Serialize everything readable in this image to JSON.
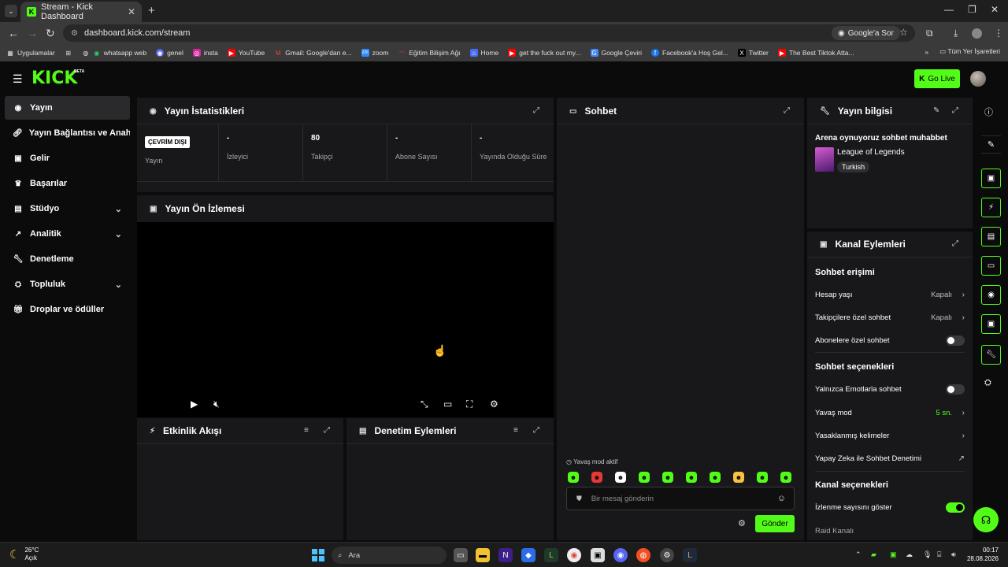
{
  "browser": {
    "tab_title": "Stream - Kick Dashboard",
    "url": "dashboard.kick.com/stream",
    "google_ask": "Google'a Sor",
    "bookmarks": [
      "Uygulamalar",
      "whatsapp web",
      "genel",
      "insta",
      "YouTube",
      "Gmail: Google'dan e...",
      "zoom",
      "Eğitim Bilişim Ağı",
      "Home",
      "get the fuck out my...",
      "Google Çeviri",
      "Facebook'a Hoş Gel...",
      "Twitter",
      "The Best Tiktok Atta..."
    ],
    "all_bookmarks": "Tüm Yer İşaretleri"
  },
  "header": {
    "logo": "KICK",
    "beta": "BETA",
    "go_live": "Go Live"
  },
  "sidebar": {
    "items": [
      {
        "label": "Yayın"
      },
      {
        "label": "Yayın Bağlantısı ve Anahtarı"
      },
      {
        "label": "Gelir"
      },
      {
        "label": "Başarılar"
      },
      {
        "label": "Stüdyo"
      },
      {
        "label": "Analitik"
      },
      {
        "label": "Denetleme"
      },
      {
        "label": "Topluluk"
      },
      {
        "label": "Droplar ve ödüller"
      }
    ]
  },
  "stats": {
    "title": "Yayın İstatistikleri",
    "offline": "ÇEVRİM DIŞI",
    "items": [
      {
        "value": "",
        "label": "Yayın"
      },
      {
        "value": "-",
        "label": "İzleyici"
      },
      {
        "value": "80",
        "label": "Takipçi"
      },
      {
        "value": "-",
        "label": "Abone Sayısı"
      },
      {
        "value": "-",
        "label": "Yayında Olduğu Süre"
      }
    ]
  },
  "preview": {
    "title": "Yayın Ön İzlemesi"
  },
  "activity": {
    "title": "Etkinlik Akışı"
  },
  "moderation": {
    "title": "Denetim Eylemleri"
  },
  "chat": {
    "title": "Sohbet",
    "slow_mode_note": "Yavaş mod aktif",
    "placeholder": "Bir mesaj gönderin",
    "send": "Gönder"
  },
  "stream_info": {
    "title": "Yayın bilgisi",
    "stream_title": "Arena oynuyoruz sohbet muhabbet",
    "game": "League of Legends",
    "language": "Turkish"
  },
  "channel_actions": {
    "title": "Kanal Eylemleri",
    "chat_access": "Sohbet erişimi",
    "account_age": {
      "label": "Hesap yaşı",
      "value": "Kapalı"
    },
    "followers_only": {
      "label": "Takipçilere özel sohbet",
      "value": "Kapalı"
    },
    "subscribers_only": {
      "label": "Abonelere özel sohbet",
      "on": false
    },
    "chat_options": "Sohbet seçenekleri",
    "emotes_only": {
      "label": "Yalnızca Emotlarla sohbet",
      "on": false
    },
    "slow_mode": {
      "label": "Yavaş mod",
      "value": "5 sn."
    },
    "banned_words": {
      "label": "Yasaklanmış kelimeler"
    },
    "ai_moderation": {
      "label": "Yapay Zeka ile Sohbet Denetimi"
    },
    "channel_options": "Kanal seçenekleri",
    "show_viewers": {
      "label": "İzlenme sayısını göster",
      "on": true
    },
    "raid_channel": {
      "label": "Raid Kanalı"
    }
  },
  "taskbar": {
    "temp": "26°C",
    "weather": "Açık",
    "search": "Ara",
    "time": "00:17",
    "date": "28.08.2026"
  },
  "colors": {
    "accent": "#53fc18",
    "panel": "#18181a",
    "background": "#0b0b0c"
  }
}
